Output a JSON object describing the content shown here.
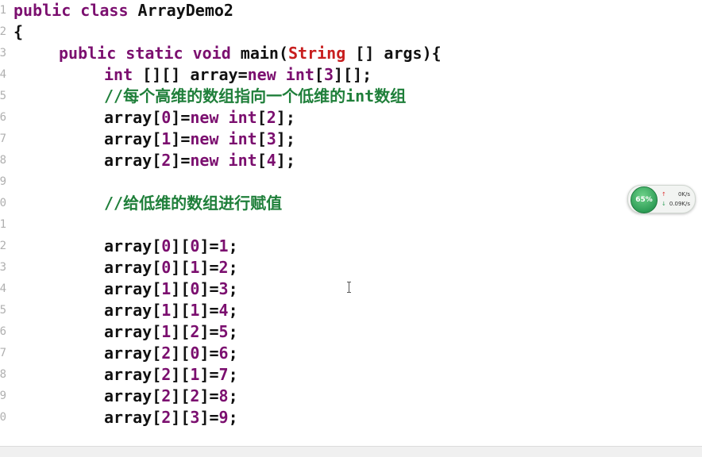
{
  "editor": {
    "line_numbers": [
      "1",
      "2",
      "3",
      "4",
      "5",
      "6",
      "7",
      "8",
      "9",
      "0",
      "1",
      "2",
      "3",
      "4",
      "5",
      "6",
      "7",
      "8",
      "9",
      "0"
    ],
    "code": {
      "l1_kw": "public class",
      "l1_id": " ArrayDemo2",
      "l2": "{",
      "l3_kw": "public static void",
      "l3_id1": " main(",
      "l3_cls": "String",
      "l3_id2": " [] args){",
      "l4_kw1": "int",
      "l4_id1": " [][] array=",
      "l4_kw2": "new int",
      "l4_id2": "[",
      "l4_num": "3",
      "l4_id3": "][];",
      "l5_comment_prefix": "//",
      "l5_comment_text": "每个高维的数组指向一个低维的",
      "l5_comment_int": "int",
      "l5_comment_tail": "数组",
      "l6_id": "array[",
      "l6_idx": "0",
      "l6_mid": "]=",
      "l6_kw": "new int",
      "l6_id2": "[",
      "l6_num": "2",
      "l6_end": "];",
      "l7_id": "array[",
      "l7_idx": "1",
      "l7_mid": "]=",
      "l7_kw": "new int",
      "l7_id2": "[",
      "l7_num": "3",
      "l7_end": "];",
      "l8_id": "array[",
      "l8_idx": "2",
      "l8_mid": "]=",
      "l8_kw": "new int",
      "l8_id2": "[",
      "l8_num": "4",
      "l8_end": "];",
      "l10_comment_prefix": "//",
      "l10_comment_text": "给低维的数组进行赋值",
      "assignments": [
        {
          "i": "0",
          "j": "0",
          "v": "1"
        },
        {
          "i": "0",
          "j": "1",
          "v": "2"
        },
        {
          "i": "1",
          "j": "0",
          "v": "3"
        },
        {
          "i": "1",
          "j": "1",
          "v": "4"
        },
        {
          "i": "1",
          "j": "2",
          "v": "5"
        },
        {
          "i": "2",
          "j": "0",
          "v": "6"
        },
        {
          "i": "2",
          "j": "1",
          "v": "7"
        },
        {
          "i": "2",
          "j": "2",
          "v": "8"
        },
        {
          "i": "2",
          "j": "3",
          "v": "9"
        }
      ],
      "assign_prefix": "array[",
      "assign_sep": "][",
      "assign_eq": "]=",
      "assign_end": ";"
    }
  },
  "net_widget": {
    "percent": "65%",
    "up_rate": "0K/s",
    "down_rate": "0.09K/s",
    "up_icon": "up-arrow-icon",
    "down_icon": "down-arrow-icon"
  },
  "colors": {
    "keyword": "#7b0f6f",
    "string_class": "#c81e1e",
    "comment": "#1f7f3a",
    "identifier": "#111111"
  }
}
